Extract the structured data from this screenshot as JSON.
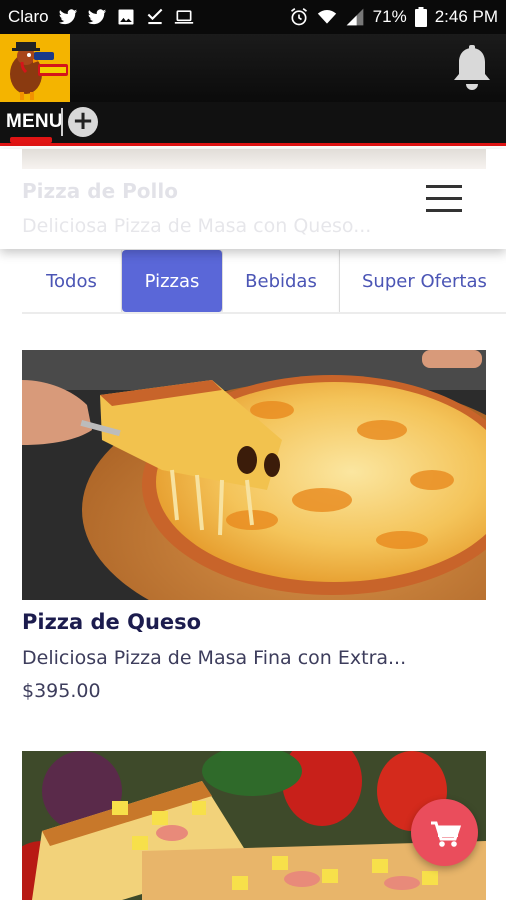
{
  "status_bar": {
    "carrier": "Claro",
    "battery": "71%",
    "time": "2:46 PM"
  },
  "header": {
    "logo_alt": "Pavo logo",
    "notification_icon": "bell-icon"
  },
  "menubar": {
    "menu_label": "MENU",
    "add_icon": "+"
  },
  "sticky_card": {
    "title": "Pizza de Pollo",
    "description": "Deliciosa Pizza de Masa con Queso..."
  },
  "tabs": [
    {
      "label": "Todos",
      "active": false
    },
    {
      "label": "Pizzas",
      "active": true
    },
    {
      "label": "Bebidas",
      "active": false
    },
    {
      "label": "Super Ofertas",
      "active": false
    }
  ],
  "products": [
    {
      "name": "Pizza de Queso",
      "description": "Deliciosa Pizza de Masa Fina con Extra...",
      "price": "$395.00"
    }
  ],
  "colors": {
    "accent": "#5a67d8",
    "brand_red": "#e01414",
    "cart_fab": "#ea4d5c",
    "title_text": "#1c1c4e"
  }
}
